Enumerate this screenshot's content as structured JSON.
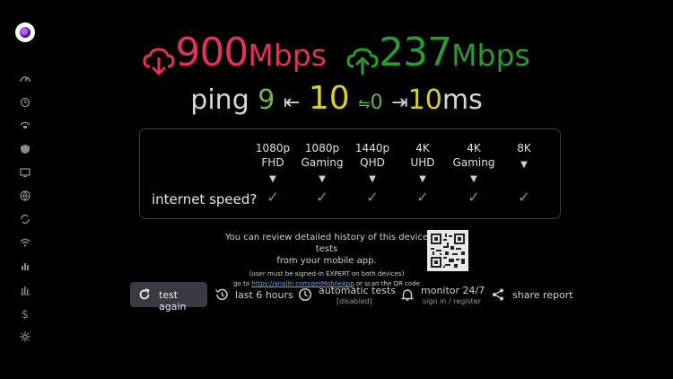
{
  "download": {
    "value": "900",
    "unit": "Mbps",
    "icon": "cloud-download-icon",
    "color": "#e03355"
  },
  "upload": {
    "value": "237",
    "unit": "Mbps",
    "icon": "cloud-upload-icon",
    "color": "#2c9a2c"
  },
  "ping": {
    "label": "ping",
    "min": "9",
    "min_arrow": "⇤",
    "mid": "10",
    "jitter_arrow": "⇋",
    "jitter": "0",
    "max_arrow": "⇥",
    "max": "10",
    "unit": "ms"
  },
  "capability": {
    "question": "internet speed?",
    "columns": [
      {
        "line1": "1080p",
        "line2": "FHD",
        "check": "✓"
      },
      {
        "line1": "1080p",
        "line2": "Gaming",
        "check": "✓"
      },
      {
        "line1": "1440p",
        "line2": "QHD",
        "check": "✓"
      },
      {
        "line1": "4K",
        "line2": "UHD",
        "check": "✓"
      },
      {
        "line1": "4K",
        "line2": "Gaming",
        "check": "✓"
      },
      {
        "line1": "8K",
        "line2": "",
        "check": "✓"
      }
    ],
    "marker": "▼"
  },
  "info": {
    "line1": "You can review detailed history of this device tests",
    "line2": "from your mobile app.",
    "note": "(user must be signed-in EXPERT on both devices)",
    "goto": "go to",
    "link": "https://analiti.com/getMobileApp",
    "suffix": "or scan the QR code"
  },
  "actions": {
    "test_again": "test again",
    "last_hours": "last 6 hours",
    "auto_tests": "automatic tests",
    "auto_tests_status": "[disabled]",
    "monitor": "monitor 24/7",
    "monitor_sub": "sign in / register",
    "share": "share report"
  },
  "sidebar": [
    "speedometer-icon",
    "history-icon",
    "wifi-router-icon",
    "shield-icon",
    "tv-icon",
    "globe-icon",
    "sync-icon",
    "wifi-icon",
    "bar-chart-icon",
    "chart-icon",
    "dollar-icon",
    "settings-icon"
  ]
}
